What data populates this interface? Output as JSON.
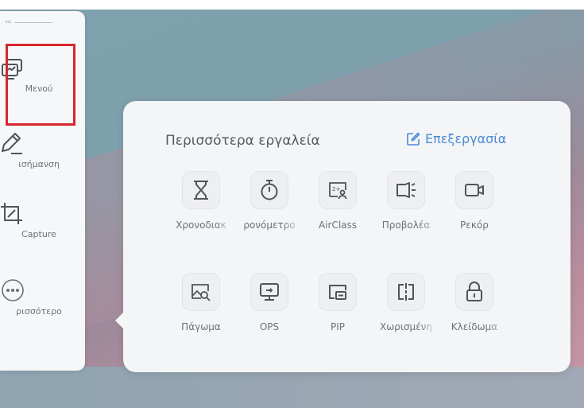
{
  "sidebar": {
    "collapse_label": "‹‹‹",
    "items": [
      {
        "label": "Μενού",
        "icon": "menu-windows-icon",
        "highlighted": true
      },
      {
        "label": "ισήμανση",
        "icon": "pen-icon"
      },
      {
        "label": "Capture",
        "icon": "crop-icon"
      },
      {
        "label": "ρισσότερο",
        "icon": "more-dots-icon"
      }
    ]
  },
  "popup": {
    "title": "Περισσότερα εργαλεία",
    "edit_label": "Επεξεργασία",
    "tools_row1": [
      {
        "label": "Χρονοδιακ",
        "icon": "hourglass-icon"
      },
      {
        "label": "ρονόμετρο",
        "icon": "stopwatch-icon"
      },
      {
        "label": "AirClass",
        "icon": "airclass-icon"
      },
      {
        "label": "Προβολέα",
        "icon": "projector-icon"
      },
      {
        "label": "Ρεκόρ",
        "icon": "video-camera-icon"
      }
    ],
    "tools_row2": [
      {
        "label": "Πάγωμα",
        "icon": "freeze-image-icon"
      },
      {
        "label": "OPS",
        "icon": "ops-monitor-icon"
      },
      {
        "label": "PIP",
        "icon": "pip-icon"
      },
      {
        "label": "Χωρισμένη",
        "icon": "split-screen-icon"
      },
      {
        "label": "Κλείδωμα",
        "icon": "lock-icon"
      }
    ]
  },
  "colors": {
    "accent": "#4a8ad6",
    "highlight_border": "#d8262d",
    "icon_stroke": "#4f545a"
  }
}
